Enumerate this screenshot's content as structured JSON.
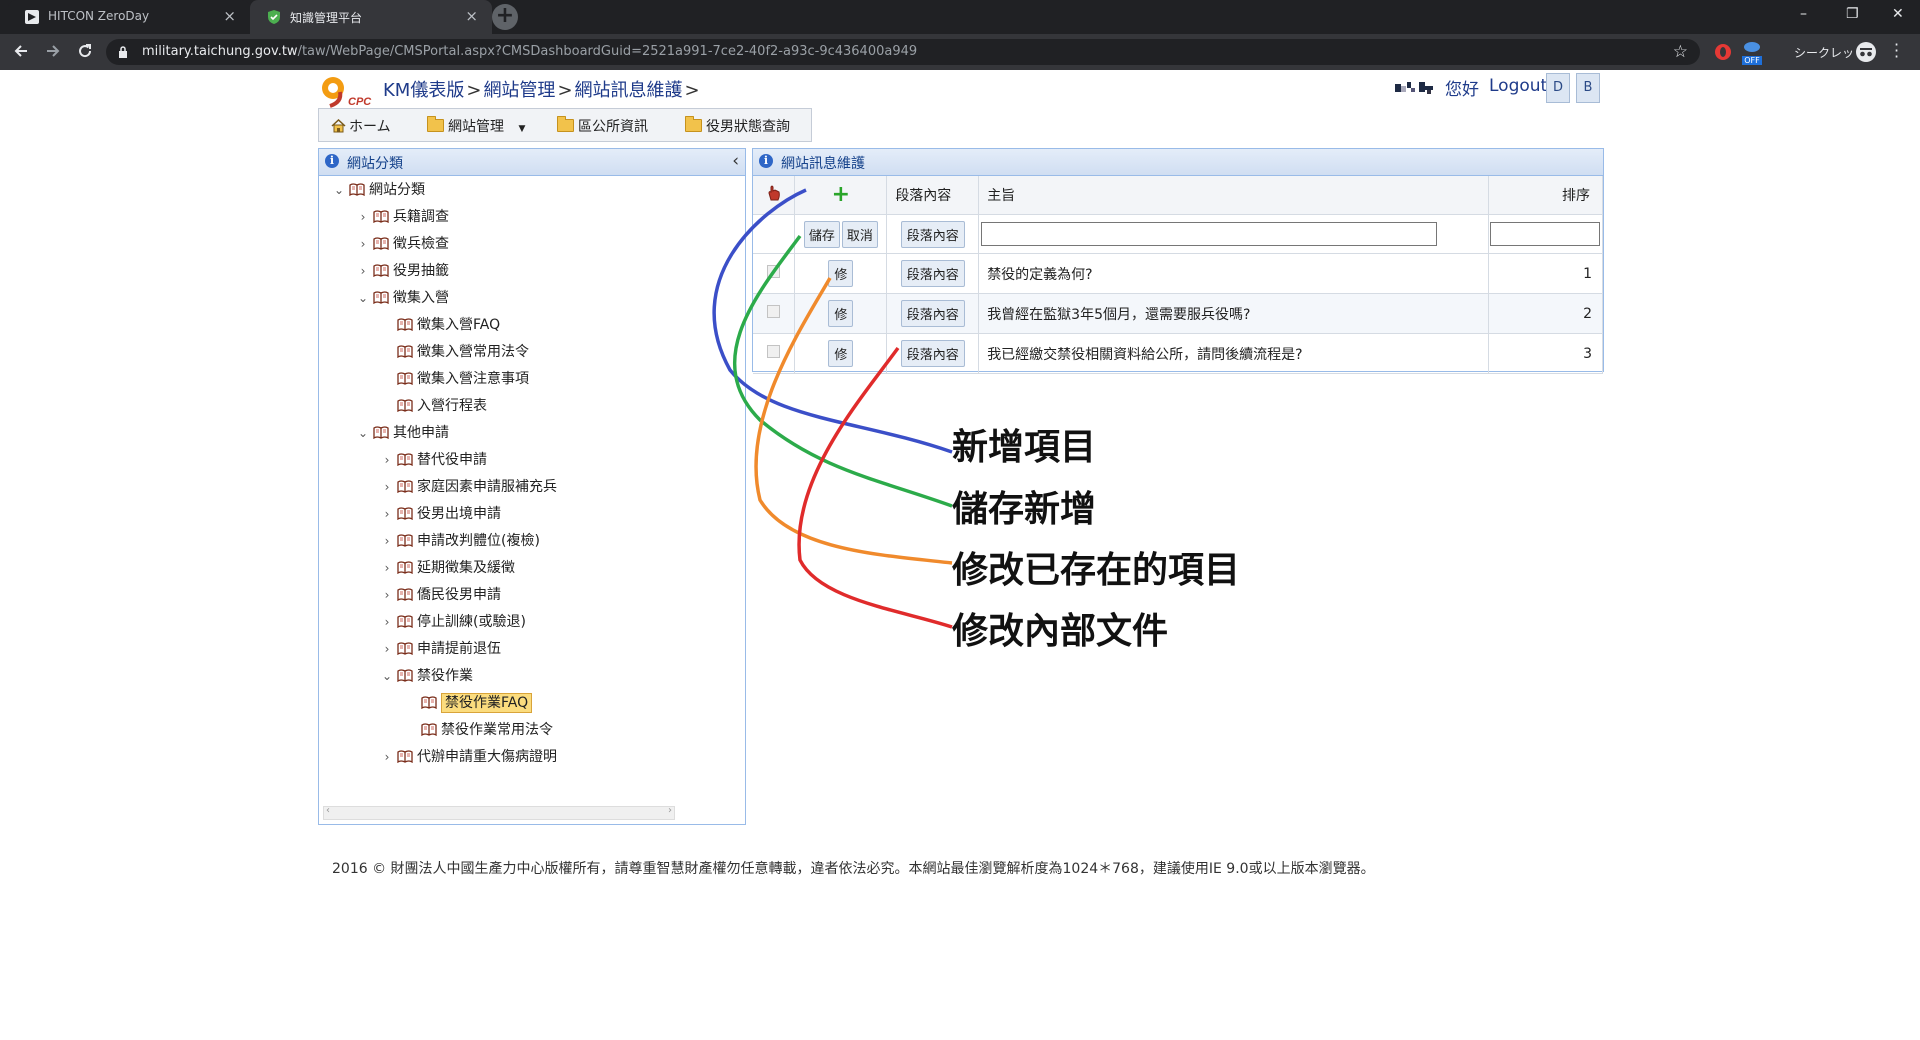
{
  "browser": {
    "tabs": [
      {
        "title": "HITCON ZeroDay",
        "close": "×"
      },
      {
        "title": "知識管理平台",
        "close": "×"
      }
    ],
    "new_tab": "+",
    "window_controls": {
      "minimize": "–",
      "restore": "❐",
      "close": "✕"
    },
    "url_host": "military.taichung.gov.tw",
    "url_path": "/taw/WebPage/CMSPortal.aspx?CMSDashboardGuid=2521a991-7ce2-40f2-a93c-9c436400a949",
    "extension_badge": "OFF",
    "incognito_label": "シークレット"
  },
  "header": {
    "logo_text": "CPC",
    "breadcrumb": [
      "KM儀表版",
      "網站管理",
      "網站訊息維護"
    ],
    "breadcrumb_sep": ">",
    "greeting": "您好",
    "logout": "Logout",
    "buttons": [
      "D",
      "B"
    ]
  },
  "menubar": {
    "home": "ホーム",
    "items": [
      "網站管理",
      "區公所資訊",
      "役男狀態查詢"
    ]
  },
  "left_panel": {
    "title": "網站分類",
    "collapse": "‹",
    "tree": [
      {
        "label": "網站分類",
        "level": 0,
        "expanded": true
      },
      {
        "label": "兵籍調查",
        "level": 1,
        "expanded": false
      },
      {
        "label": "徵兵檢查",
        "level": 1,
        "expanded": false
      },
      {
        "label": "役男抽籤",
        "level": 1,
        "expanded": false
      },
      {
        "label": "徵集入營",
        "level": 1,
        "expanded": true
      },
      {
        "label": "徵集入營FAQ",
        "level": 2,
        "leaf": true
      },
      {
        "label": "徵集入營常用法令",
        "level": 2,
        "leaf": true
      },
      {
        "label": "徵集入營注意事項",
        "level": 2,
        "leaf": true
      },
      {
        "label": "入營行程表",
        "level": 2,
        "leaf": true
      },
      {
        "label": "其他申請",
        "level": 1,
        "expanded": true
      },
      {
        "label": "替代役申請",
        "level": 2,
        "expanded": false
      },
      {
        "label": "家庭因素申請服補充兵",
        "level": 2,
        "expanded": false
      },
      {
        "label": "役男出境申請",
        "level": 2,
        "expanded": false
      },
      {
        "label": "申請改判體位(複檢)",
        "level": 2,
        "expanded": false
      },
      {
        "label": "延期徵集及緩徵",
        "level": 2,
        "expanded": false
      },
      {
        "label": "僑民役男申請",
        "level": 2,
        "expanded": false
      },
      {
        "label": "停止訓練(或驗退)",
        "level": 2,
        "expanded": false
      },
      {
        "label": "申請提前退伍",
        "level": 2,
        "expanded": false
      },
      {
        "label": "禁役作業",
        "level": 2,
        "expanded": true
      },
      {
        "label": "禁役作業FAQ",
        "level": 3,
        "leaf": true,
        "selected": true
      },
      {
        "label": "禁役作業常用法令",
        "level": 3,
        "leaf": true
      },
      {
        "label": "代辦申請重大傷病證明",
        "level": 2,
        "expanded": false
      }
    ]
  },
  "right_panel": {
    "title": "網站訊息維護",
    "columns": {
      "content": "段落內容",
      "subject": "主旨",
      "order": "排序"
    },
    "add_icon": "+",
    "edit_row": {
      "save": "儲存",
      "cancel": "取消",
      "content_btn": "段落內容",
      "subject_value": "",
      "order_value": ""
    },
    "rows": [
      {
        "edit": "修",
        "content_btn": "段落內容",
        "subject": "禁役的定義為何?",
        "order": "1"
      },
      {
        "edit": "修",
        "content_btn": "段落內容",
        "subject": "我曾經在監獄3年5個月，還需要服兵役嗎?",
        "order": "2"
      },
      {
        "edit": "修",
        "content_btn": "段落內容",
        "subject": "我已經繳交禁役相關資料給公所，請問後續流程是?",
        "order": "3"
      }
    ]
  },
  "annotations": [
    {
      "label": "新增項目",
      "color": "#3b4fc8"
    },
    {
      "label": "儲存新增",
      "color": "#2cab4a"
    },
    {
      "label": "修改已存在的項目",
      "color": "#f08a2c"
    },
    {
      "label": "修改內部文件",
      "color": "#e02b2b"
    }
  ],
  "footer": "2016 © 財團法人中國生產力中心版權所有，請尊重智慧財產權勿任意轉載，違者依法必究。本網站最佳瀏覽解析度為1024＊768，建議使用IE 9.0或以上版本瀏覽器。"
}
